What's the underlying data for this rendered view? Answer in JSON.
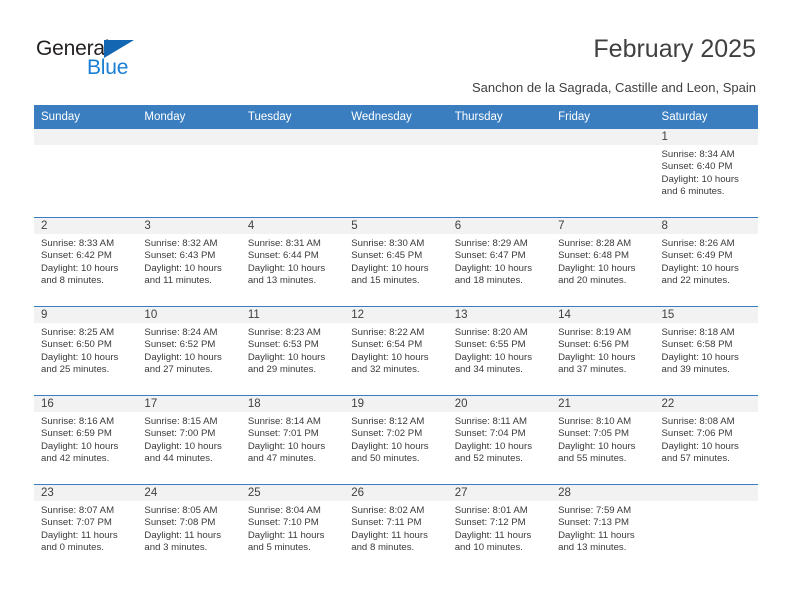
{
  "brand": {
    "name_part1": "General",
    "name_part2": "Blue",
    "triangle_color": "#1266b2",
    "blue_color": "#1a7fd4"
  },
  "header": {
    "title": "February 2025",
    "subtitle": "Sanchon de la Sagrada, Castille and Leon, Spain",
    "header_bg": "#3b7ec0",
    "daynum_bg": "#f2f2f2"
  },
  "weekdays": [
    "Sunday",
    "Monday",
    "Tuesday",
    "Wednesday",
    "Thursday",
    "Friday",
    "Saturday"
  ],
  "weeks": [
    [
      {
        "day": "",
        "sunrise": "",
        "sunset": "",
        "daylight": "",
        "empty": true
      },
      {
        "day": "",
        "sunrise": "",
        "sunset": "",
        "daylight": "",
        "empty": true
      },
      {
        "day": "",
        "sunrise": "",
        "sunset": "",
        "daylight": "",
        "empty": true
      },
      {
        "day": "",
        "sunrise": "",
        "sunset": "",
        "daylight": "",
        "empty": true
      },
      {
        "day": "",
        "sunrise": "",
        "sunset": "",
        "daylight": "",
        "empty": true
      },
      {
        "day": "",
        "sunrise": "",
        "sunset": "",
        "daylight": "",
        "empty": true
      },
      {
        "day": "1",
        "sunrise": "Sunrise: 8:34 AM",
        "sunset": "Sunset: 6:40 PM",
        "daylight": "Daylight: 10 hours and 6 minutes.",
        "empty": false
      }
    ],
    [
      {
        "day": "2",
        "sunrise": "Sunrise: 8:33 AM",
        "sunset": "Sunset: 6:42 PM",
        "daylight": "Daylight: 10 hours and 8 minutes.",
        "empty": false
      },
      {
        "day": "3",
        "sunrise": "Sunrise: 8:32 AM",
        "sunset": "Sunset: 6:43 PM",
        "daylight": "Daylight: 10 hours and 11 minutes.",
        "empty": false
      },
      {
        "day": "4",
        "sunrise": "Sunrise: 8:31 AM",
        "sunset": "Sunset: 6:44 PM",
        "daylight": "Daylight: 10 hours and 13 minutes.",
        "empty": false
      },
      {
        "day": "5",
        "sunrise": "Sunrise: 8:30 AM",
        "sunset": "Sunset: 6:45 PM",
        "daylight": "Daylight: 10 hours and 15 minutes.",
        "empty": false
      },
      {
        "day": "6",
        "sunrise": "Sunrise: 8:29 AM",
        "sunset": "Sunset: 6:47 PM",
        "daylight": "Daylight: 10 hours and 18 minutes.",
        "empty": false
      },
      {
        "day": "7",
        "sunrise": "Sunrise: 8:28 AM",
        "sunset": "Sunset: 6:48 PM",
        "daylight": "Daylight: 10 hours and 20 minutes.",
        "empty": false
      },
      {
        "day": "8",
        "sunrise": "Sunrise: 8:26 AM",
        "sunset": "Sunset: 6:49 PM",
        "daylight": "Daylight: 10 hours and 22 minutes.",
        "empty": false
      }
    ],
    [
      {
        "day": "9",
        "sunrise": "Sunrise: 8:25 AM",
        "sunset": "Sunset: 6:50 PM",
        "daylight": "Daylight: 10 hours and 25 minutes.",
        "empty": false
      },
      {
        "day": "10",
        "sunrise": "Sunrise: 8:24 AM",
        "sunset": "Sunset: 6:52 PM",
        "daylight": "Daylight: 10 hours and 27 minutes.",
        "empty": false
      },
      {
        "day": "11",
        "sunrise": "Sunrise: 8:23 AM",
        "sunset": "Sunset: 6:53 PM",
        "daylight": "Daylight: 10 hours and 29 minutes.",
        "empty": false
      },
      {
        "day": "12",
        "sunrise": "Sunrise: 8:22 AM",
        "sunset": "Sunset: 6:54 PM",
        "daylight": "Daylight: 10 hours and 32 minutes.",
        "empty": false
      },
      {
        "day": "13",
        "sunrise": "Sunrise: 8:20 AM",
        "sunset": "Sunset: 6:55 PM",
        "daylight": "Daylight: 10 hours and 34 minutes.",
        "empty": false
      },
      {
        "day": "14",
        "sunrise": "Sunrise: 8:19 AM",
        "sunset": "Sunset: 6:56 PM",
        "daylight": "Daylight: 10 hours and 37 minutes.",
        "empty": false
      },
      {
        "day": "15",
        "sunrise": "Sunrise: 8:18 AM",
        "sunset": "Sunset: 6:58 PM",
        "daylight": "Daylight: 10 hours and 39 minutes.",
        "empty": false
      }
    ],
    [
      {
        "day": "16",
        "sunrise": "Sunrise: 8:16 AM",
        "sunset": "Sunset: 6:59 PM",
        "daylight": "Daylight: 10 hours and 42 minutes.",
        "empty": false
      },
      {
        "day": "17",
        "sunrise": "Sunrise: 8:15 AM",
        "sunset": "Sunset: 7:00 PM",
        "daylight": "Daylight: 10 hours and 44 minutes.",
        "empty": false
      },
      {
        "day": "18",
        "sunrise": "Sunrise: 8:14 AM",
        "sunset": "Sunset: 7:01 PM",
        "daylight": "Daylight: 10 hours and 47 minutes.",
        "empty": false
      },
      {
        "day": "19",
        "sunrise": "Sunrise: 8:12 AM",
        "sunset": "Sunset: 7:02 PM",
        "daylight": "Daylight: 10 hours and 50 minutes.",
        "empty": false
      },
      {
        "day": "20",
        "sunrise": "Sunrise: 8:11 AM",
        "sunset": "Sunset: 7:04 PM",
        "daylight": "Daylight: 10 hours and 52 minutes.",
        "empty": false
      },
      {
        "day": "21",
        "sunrise": "Sunrise: 8:10 AM",
        "sunset": "Sunset: 7:05 PM",
        "daylight": "Daylight: 10 hours and 55 minutes.",
        "empty": false
      },
      {
        "day": "22",
        "sunrise": "Sunrise: 8:08 AM",
        "sunset": "Sunset: 7:06 PM",
        "daylight": "Daylight: 10 hours and 57 minutes.",
        "empty": false
      }
    ],
    [
      {
        "day": "23",
        "sunrise": "Sunrise: 8:07 AM",
        "sunset": "Sunset: 7:07 PM",
        "daylight": "Daylight: 11 hours and 0 minutes.",
        "empty": false
      },
      {
        "day": "24",
        "sunrise": "Sunrise: 8:05 AM",
        "sunset": "Sunset: 7:08 PM",
        "daylight": "Daylight: 11 hours and 3 minutes.",
        "empty": false
      },
      {
        "day": "25",
        "sunrise": "Sunrise: 8:04 AM",
        "sunset": "Sunset: 7:10 PM",
        "daylight": "Daylight: 11 hours and 5 minutes.",
        "empty": false
      },
      {
        "day": "26",
        "sunrise": "Sunrise: 8:02 AM",
        "sunset": "Sunset: 7:11 PM",
        "daylight": "Daylight: 11 hours and 8 minutes.",
        "empty": false
      },
      {
        "day": "27",
        "sunrise": "Sunrise: 8:01 AM",
        "sunset": "Sunset: 7:12 PM",
        "daylight": "Daylight: 11 hours and 10 minutes.",
        "empty": false
      },
      {
        "day": "28",
        "sunrise": "Sunrise: 7:59 AM",
        "sunset": "Sunset: 7:13 PM",
        "daylight": "Daylight: 11 hours and 13 minutes.",
        "empty": false
      },
      {
        "day": "",
        "sunrise": "",
        "sunset": "",
        "daylight": "",
        "empty": true
      }
    ]
  ]
}
